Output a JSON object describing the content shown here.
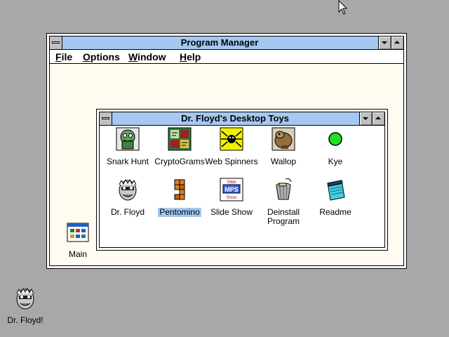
{
  "program_manager": {
    "title": "Program Manager",
    "menu": [
      {
        "letter": "F",
        "rest": "ile"
      },
      {
        "letter": "O",
        "rest": "ptions"
      },
      {
        "letter": "W",
        "rest": "indow"
      },
      {
        "letter": "H",
        "rest": "elp"
      }
    ]
  },
  "group_window": {
    "title": "Dr. Floyd's Desktop Toys",
    "icons": [
      {
        "label": "Snark Hunt",
        "icon": "snark-hunt-icon"
      },
      {
        "label": "CryptoGrams",
        "icon": "cryptograms-icon"
      },
      {
        "label": "Web Spinners",
        "icon": "web-spinners-icon"
      },
      {
        "label": "Wallop",
        "icon": "wallop-icon"
      },
      {
        "label": "Kye",
        "icon": "kye-icon"
      },
      {
        "label": "Dr. Floyd",
        "icon": "dr-floyd-icon"
      },
      {
        "label": "Pentomino",
        "icon": "pentomino-icon",
        "selected": true
      },
      {
        "label": "Slide Show",
        "icon": "slide-show-icon",
        "badge_top": "Slide",
        "badge_mid": "MPS",
        "badge_bottom": "Show"
      },
      {
        "label": "Deinstall",
        "label2": "Program",
        "icon": "trash-can-icon"
      },
      {
        "label": "Readme",
        "icon": "notepad-icon"
      }
    ]
  },
  "minimized_groups": [
    {
      "label": "Main",
      "icon": "program-group-icon"
    }
  ],
  "desktop_icons": [
    {
      "label": "Dr. Floyd!",
      "icon": "dr-floyd-icon"
    }
  ],
  "colors": {
    "desktop": "#a8a8a8",
    "titlebar": "#a4c8f0",
    "selection": "#a4c8f0",
    "window_bg": "#fffbf0"
  }
}
